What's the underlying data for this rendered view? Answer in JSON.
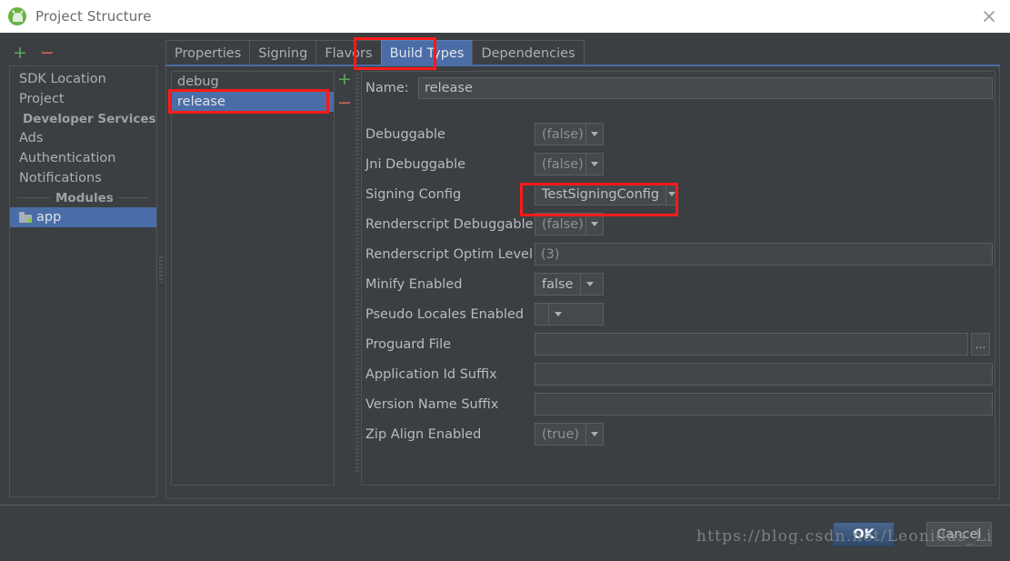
{
  "window": {
    "title": "Project Structure",
    "icon": "android-studio-icon",
    "close_icon": "close-icon"
  },
  "sidebar": {
    "add_label": "+",
    "remove_label": "−",
    "items": [
      {
        "type": "item",
        "label": "SDK Location",
        "selected": false
      },
      {
        "type": "item",
        "label": "Project",
        "selected": false
      },
      {
        "type": "separator",
        "label": "Developer Services"
      },
      {
        "type": "item",
        "label": "Ads",
        "selected": false
      },
      {
        "type": "item",
        "label": "Authentication",
        "selected": false
      },
      {
        "type": "item",
        "label": "Notifications",
        "selected": false
      },
      {
        "type": "separator",
        "label": "Modules"
      },
      {
        "type": "item",
        "label": "app",
        "selected": true,
        "icon": "folder-icon"
      }
    ]
  },
  "tabs": [
    {
      "label": "Properties",
      "active": false
    },
    {
      "label": "Signing",
      "active": false
    },
    {
      "label": "Flavors",
      "active": false
    },
    {
      "label": "Build Types",
      "active": true
    },
    {
      "label": "Dependencies",
      "active": false
    }
  ],
  "build_types": {
    "add_label": "+",
    "remove_label": "−",
    "items": [
      {
        "label": "debug",
        "selected": false
      },
      {
        "label": "release",
        "selected": true
      }
    ]
  },
  "form": {
    "name_label": "Name:",
    "name_value": "release",
    "rows": [
      {
        "label": "Debuggable",
        "control": "combo",
        "value": "(false)",
        "value_state": "placeholder",
        "width": "w-bool"
      },
      {
        "label": "Jni Debuggable",
        "control": "combo",
        "value": "(false)",
        "value_state": "placeholder",
        "width": "w-bool"
      },
      {
        "label": "Signing Config",
        "control": "combo",
        "value": "TestSigningConfig",
        "value_state": "set",
        "width": "w-signing"
      },
      {
        "label": "Renderscript Debuggable",
        "control": "combo",
        "value": "(false)",
        "value_state": "placeholder",
        "width": "w-bool"
      },
      {
        "label": "Renderscript Optim Level",
        "control": "text",
        "value": "(3)",
        "value_state": "placeholder",
        "width": "tf-optim"
      },
      {
        "label": "Minify Enabled",
        "control": "combo",
        "value": "false",
        "value_state": "set",
        "width": "w-minify"
      },
      {
        "label": "Pseudo Locales Enabled",
        "control": "combo",
        "value": "",
        "value_state": "placeholder",
        "width": "w-pseudo"
      },
      {
        "label": "Proguard File",
        "control": "text-ellipsis",
        "value": "",
        "value_state": "placeholder",
        "width": "tf-proguard",
        "ellipsis_label": "…"
      },
      {
        "label": "Application Id Suffix",
        "control": "text",
        "value": "",
        "value_state": "placeholder",
        "width": "tf-suffix"
      },
      {
        "label": "Version Name Suffix",
        "control": "text",
        "value": "",
        "value_state": "placeholder",
        "width": "tf-suffix"
      },
      {
        "label": "Zip Align Enabled",
        "control": "combo",
        "value": "(true)",
        "value_state": "placeholder",
        "width": "w-bool"
      }
    ]
  },
  "footer": {
    "ok_label": "OK",
    "cancel_label": "Cancel",
    "watermark": "https://blog.csdn.net/Leonidas_Li"
  },
  "annotations": {
    "color": "#ff1a1a",
    "targets": [
      "tab-build-types",
      "build-type-release",
      "signing-config-combo"
    ]
  }
}
